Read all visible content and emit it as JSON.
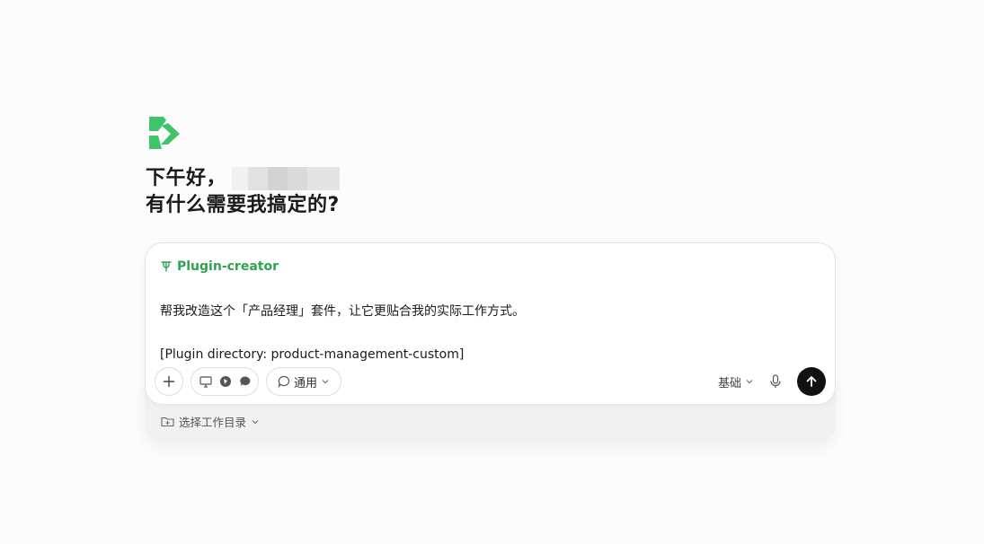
{
  "greeting": {
    "line1": "下午好，",
    "line2": "有什么需要我搞定的?"
  },
  "composer": {
    "plugin_tag": "Plugin-creator",
    "prompt_line1": "帮我改造这个「产品经理」套件，让它更贴合我的实际工作方式。",
    "prompt_line2": "[Plugin directory: product-management-custom]",
    "mode_label": "通用",
    "level_label": "基础"
  },
  "footer": {
    "workdir_label": "选择工作目录"
  },
  "icons": {
    "logo": "app-logo",
    "plugin": "plugin-icon",
    "add": "plus-icon",
    "tools": [
      "monitor-icon",
      "globe-icon",
      "chat-bubble-icon"
    ],
    "mode": "chat-bubble-outline-icon",
    "mic": "mic-icon",
    "send": "arrow-up-icon",
    "folder": "folder-add-icon"
  },
  "colors": {
    "brand": "#2ea44f",
    "logo": "#3fc46a",
    "send_button": "#111111"
  }
}
